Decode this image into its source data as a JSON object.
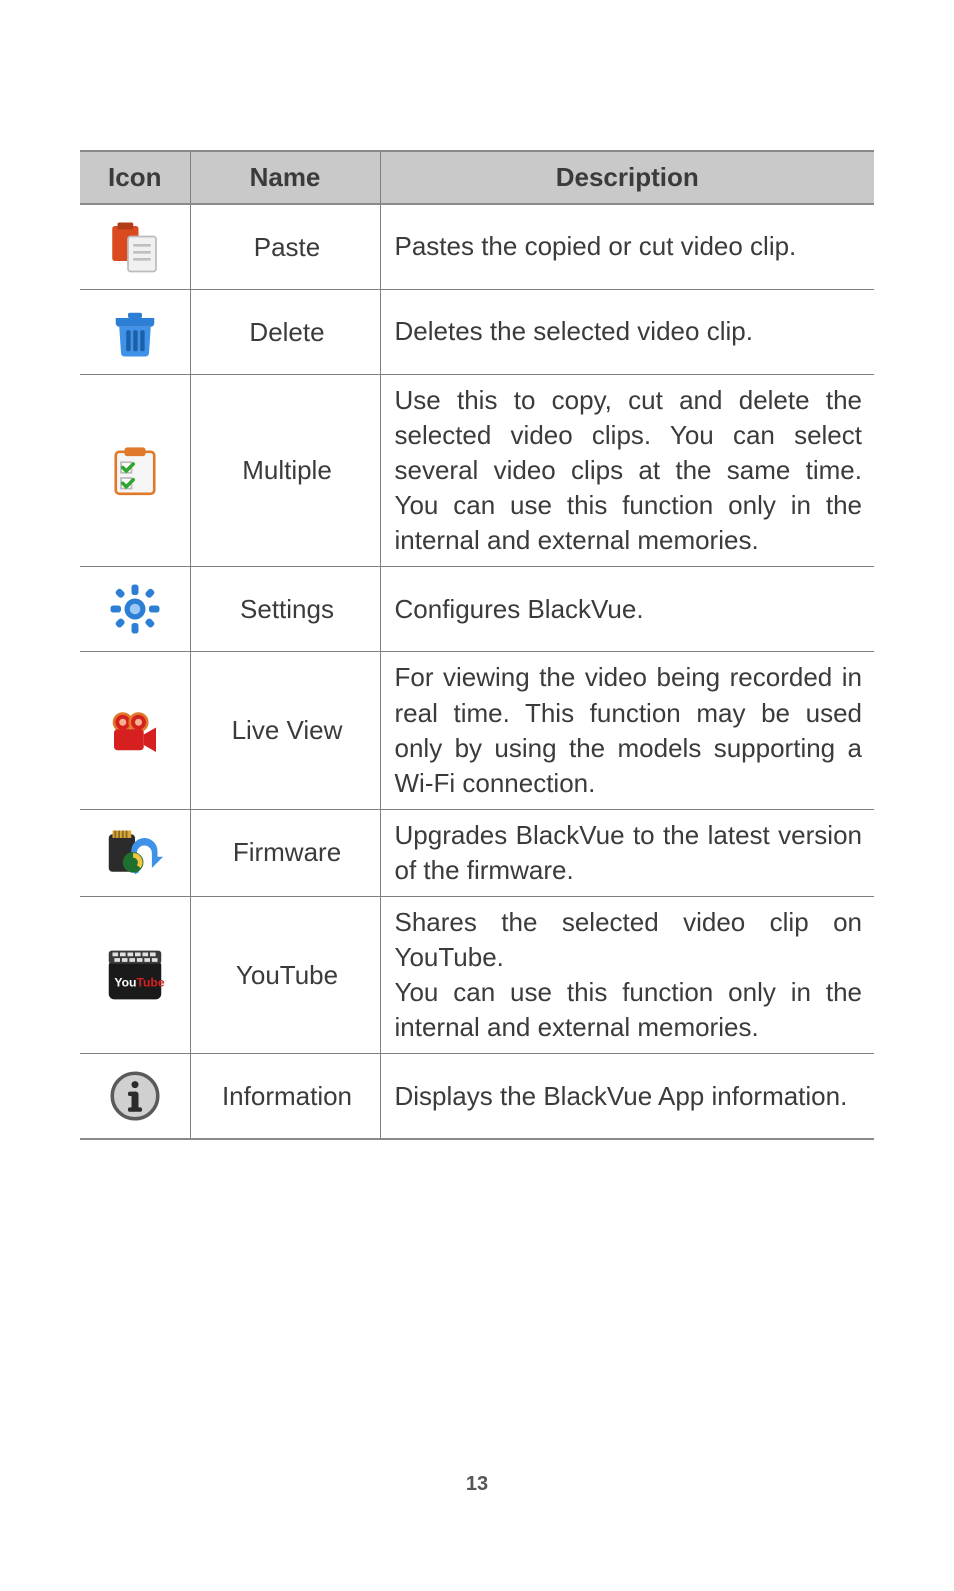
{
  "headers": {
    "icon": "Icon",
    "name": "Name",
    "description": "Description"
  },
  "rows": [
    {
      "icon_name": "paste-icon",
      "name": "Paste",
      "description": "Pastes the copied or cut video clip."
    },
    {
      "icon_name": "delete-icon",
      "name": "Delete",
      "description": "Deletes the selected video clip."
    },
    {
      "icon_name": "multiple-icon",
      "name": "Multiple",
      "description": "Use this to copy, cut and delete the selected video clips. You can select several video clips at the same time.  You can use this func­tion only in the internal and exter­nal memories."
    },
    {
      "icon_name": "settings-icon",
      "name": "Settings",
      "description": "Configures BlackVue."
    },
    {
      "icon_name": "liveview-icon",
      "name": "Live View",
      "description": "For viewing the video being record­ed in real time. This function may be used only by using the models supporting a Wi-Fi connection."
    },
    {
      "icon_name": "firmware-icon",
      "name": "Firmware",
      "description": "Upgrades BlackVue to the latest version of the firmware."
    },
    {
      "icon_name": "youtube-icon",
      "name": "YouTube",
      "description": "Shares the selected video clip on YouTube.\nYou can use this function only in the internal and external memories."
    },
    {
      "icon_name": "information-icon",
      "name": "Information",
      "description": "Displays the BlackVue App infor­mation."
    }
  ],
  "page_number": "13"
}
